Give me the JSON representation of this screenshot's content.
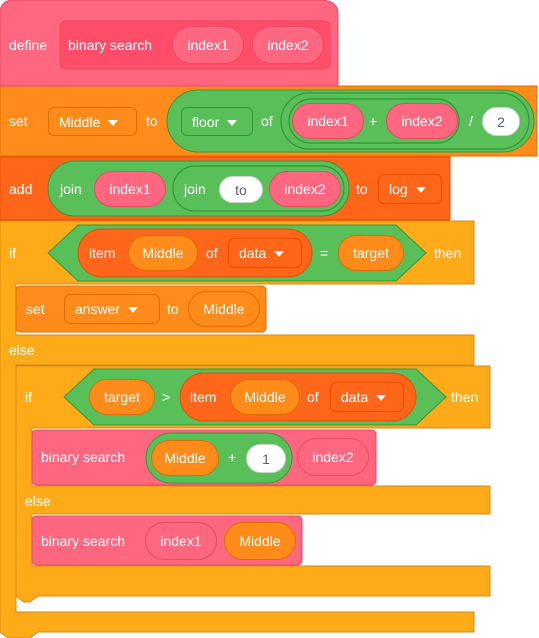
{
  "colors": {
    "custom": "#ff6680",
    "custom_dark": "#ff4d6a",
    "custom_edge": "#e64a66",
    "variables": "#ff8c1a",
    "variables_edge": "#db6e00",
    "lists": "#ff661a",
    "lists_edge": "#e64d00",
    "operators": "#59c059",
    "operators_edge": "#389438",
    "control": "#ffab19",
    "control_edge": "#cf8b17"
  },
  "define_block": {
    "keyword": "define",
    "name": "binary search",
    "param1": "index1",
    "param2": "index2"
  },
  "set_middle": {
    "keyword": "set",
    "variable": "Middle",
    "to": "to",
    "floor_op": "floor",
    "of": "of",
    "add_a": "index1",
    "plus": "+",
    "add_b": "index2",
    "divide": "/",
    "divisor": "2"
  },
  "add_log": {
    "keyword": "add",
    "join1": "join",
    "join1_a": "index1",
    "join2": "join",
    "join2_a": "to",
    "join2_b": "index2",
    "to": "to",
    "list": "log"
  },
  "if_outer": {
    "keyword": "if",
    "item": "item",
    "index_var": "Middle",
    "of": "of",
    "list": "data",
    "equals": "=",
    "compare": "target",
    "then": "then"
  },
  "set_answer": {
    "keyword": "set",
    "variable": "answer",
    "to": "to",
    "value": "Middle"
  },
  "else_outer": "else",
  "if_inner": {
    "keyword": "if",
    "left": "target",
    "greater": ">",
    "item": "item",
    "index_var": "Middle",
    "of": "of",
    "list": "data",
    "then": "then"
  },
  "call1": {
    "name": "binary search",
    "arg1_a": "Middle",
    "arg1_plus": "+",
    "arg1_b": "1",
    "arg2": "index2"
  },
  "else_inner": "else",
  "call2": {
    "name": "binary search",
    "arg1": "index1",
    "arg2": "Middle"
  }
}
